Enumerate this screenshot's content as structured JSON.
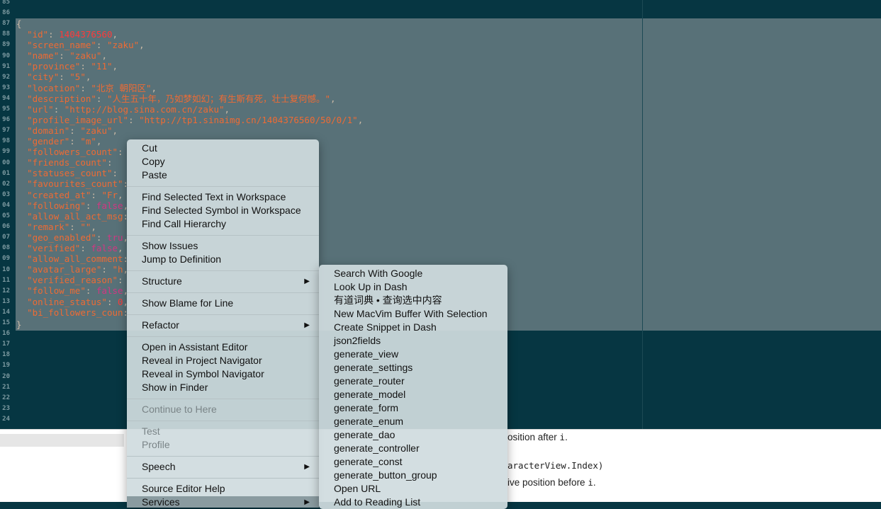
{
  "editor": {
    "line_numbers": [
      "85",
      "86",
      "87",
      "88",
      "89",
      "90",
      "91",
      "92",
      "93",
      "94",
      "95",
      "96",
      "97",
      "98",
      "99",
      "00",
      "01",
      "02",
      "03",
      "04",
      "05",
      "06",
      "07",
      "08",
      "09",
      "10",
      "11",
      "12",
      "13",
      "14",
      "15",
      "16",
      "17",
      "18",
      "19",
      "20",
      "21",
      "22",
      "23",
      "24"
    ],
    "open_brace": "{",
    "close_brace": "}",
    "lines": [
      {
        "key": "\"id\"",
        "val": "1404376560",
        "cls": "n"
      },
      {
        "key": "\"screen_name\"",
        "val": "\"zaku\"",
        "cls": "s"
      },
      {
        "key": "\"name\"",
        "val": "\"zaku\"",
        "cls": "s"
      },
      {
        "key": "\"province\"",
        "val": "\"11\"",
        "cls": "s"
      },
      {
        "key": "\"city\"",
        "val": "\"5\"",
        "cls": "s"
      },
      {
        "key": "\"location\"",
        "val": "\"北京 朝阳区\"",
        "cls": "s"
      },
      {
        "key": "\"description\"",
        "val": "\"人生五十年，乃如梦如幻；有生斯有死，壮士复何憾。\"",
        "cls": "s"
      },
      {
        "key": "\"url\"",
        "val": "\"http://blog.sina.com.cn/zaku\"",
        "cls": "s"
      },
      {
        "key": "\"profile_image_url\"",
        "val": "\"http://tp1.sinaimg.cn/1404376560/50/0/1\"",
        "cls": "s"
      },
      {
        "key": "\"domain\"",
        "val": "\"zaku\"",
        "cls": "s"
      },
      {
        "key": "\"gender\"",
        "val": "\"m\"",
        "cls": "s"
      },
      {
        "key": "\"followers_count\"",
        "val": "",
        "cls": "s"
      },
      {
        "key": "\"friends_count\"",
        "val": "",
        "cls": "s"
      },
      {
        "key": "\"statuses_count\"",
        "val": "",
        "cls": "s"
      },
      {
        "key": "\"favourites_count\"",
        "val": "",
        "cls": "s"
      },
      {
        "key": "\"created_at\"",
        "val": "\"Fr",
        "cls": "s"
      },
      {
        "key": "\"following\"",
        "val": "false",
        "cls": "k"
      },
      {
        "key": "\"allow_all_act_msg",
        "val": "",
        "cls": "s"
      },
      {
        "key": "\"remark\"",
        "val": "\"\"",
        "cls": "s"
      },
      {
        "key": "\"geo_enabled\"",
        "val": "tru",
        "cls": "k"
      },
      {
        "key": "\"verified\"",
        "val": "false",
        "cls": "k"
      },
      {
        "key": "\"allow_all_comment",
        "val": "",
        "cls": "s"
      },
      {
        "key": "\"avatar_large\"",
        "val": "\"h",
        "cls": "s"
      },
      {
        "key": "\"verified_reason\"",
        "val": "",
        "cls": "s"
      },
      {
        "key": "\"follow_me\"",
        "val": "false",
        "cls": "k"
      },
      {
        "key": "\"online_status\"",
        "val": "0",
        "cls": "n"
      },
      {
        "key": "\"bi_followers_coun",
        "val": "",
        "cls": "s"
      }
    ]
  },
  "doc_panel": {
    "line1_text": "osition after ",
    "line1_code": "i",
    "line1_end": ".",
    "line2_code": "aracterView.Index)",
    "line3_text": "ive position before ",
    "line3_code": "i",
    "line3_end": "."
  },
  "context_menu": {
    "cut": "Cut",
    "copy": "Copy",
    "paste": "Paste",
    "find_selected_text": "Find Selected Text in Workspace",
    "find_selected_symbol": "Find Selected Symbol in Workspace",
    "find_call_hierarchy": "Find Call Hierarchy",
    "show_issues": "Show Issues",
    "jump_to_definition": "Jump to Definition",
    "structure": "Structure",
    "show_blame": "Show Blame for Line",
    "refactor": "Refactor",
    "open_assistant": "Open in Assistant Editor",
    "reveal_project": "Reveal in Project Navigator",
    "reveal_symbol": "Reveal in Symbol Navigator",
    "show_in_finder": "Show in Finder",
    "continue_to_here": "Continue to Here",
    "test": "Test",
    "profile": "Profile",
    "speech": "Speech",
    "source_editor_help": "Source Editor Help",
    "services": "Services",
    "submenu_arrow": "▶"
  },
  "services_menu": {
    "items": [
      "Search With Google",
      "Look Up in Dash",
      "有道词典 • 查询选中内容",
      "New MacVim Buffer With Selection",
      "Create Snippet in Dash",
      "json2fields",
      "generate_view",
      "generate_settings",
      "generate_router",
      "generate_model",
      "generate_form",
      "generate_enum",
      "generate_dao",
      "generate_controller",
      "generate_const",
      "generate_button_group",
      "Open URL",
      "Add to Reading List"
    ]
  }
}
